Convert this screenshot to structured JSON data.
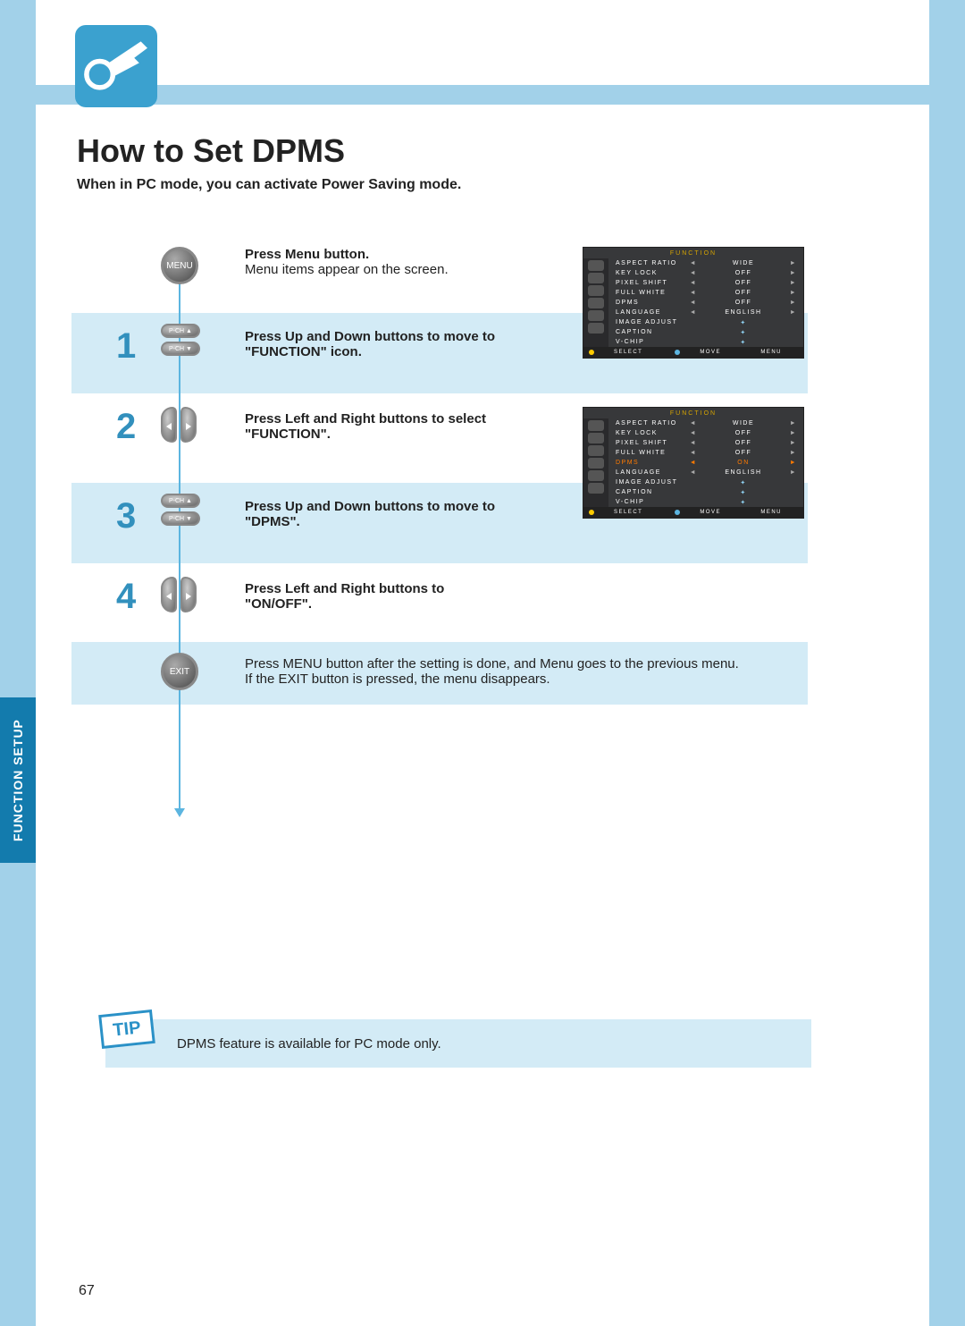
{
  "page_number": "67",
  "side_tab": "FUNCTION SETUP",
  "title": "How to Set DPMS",
  "subtitle": "When in PC mode, you can activate Power Saving mode.",
  "steps": {
    "menu": {
      "icon_label": "MENU",
      "bold": "Press Menu button.",
      "light": "Menu items appear on the screen."
    },
    "s1": {
      "num": "1",
      "pill_up": "P-CH ▲",
      "pill_dn": "P-CH ▼",
      "line1": "Press Up and Down buttons to move to",
      "line2": "\"FUNCTION\" icon."
    },
    "s2": {
      "num": "2",
      "line1": "Press Left and Right buttons to select",
      "line2": "\"FUNCTION\"."
    },
    "s3": {
      "num": "3",
      "pill_up": "P-CH ▲",
      "pill_dn": "P-CH ▼",
      "line1": "Press Up and Down buttons to move to",
      "line2": "\"DPMS\"."
    },
    "s4": {
      "num": "4",
      "line1": "Press Left and Right buttons to",
      "line2": "\"ON/OFF\"."
    },
    "exit": {
      "icon_label": "EXIT",
      "line1": "Press MENU button after the setting is done, and Menu goes to the previous menu.",
      "line2": "If the EXIT button is pressed, the menu disappears."
    }
  },
  "tip": {
    "badge": "TIP",
    "text": "DPMS feature is available for PC mode only."
  },
  "osd": {
    "header": "FUNCTION",
    "rows": [
      {
        "label": "ASPECT RATIO",
        "value": "WIDE",
        "arrows": true
      },
      {
        "label": "KEY LOCK",
        "value": "OFF",
        "arrows": true
      },
      {
        "label": "PIXEL SHIFT",
        "value": "OFF",
        "arrows": true
      },
      {
        "label": "FULL WHITE",
        "value": "OFF",
        "arrows": true
      },
      {
        "label": "DPMS",
        "value": "OFF",
        "arrows": true,
        "hi_key": true
      },
      {
        "label": "LANGUAGE",
        "value": "ENGLISH",
        "arrows": true
      },
      {
        "label": "IMAGE ADJUST",
        "dot": true
      },
      {
        "label": "CAPTION",
        "dot": true
      },
      {
        "label": "V-CHIP",
        "dot": true
      }
    ],
    "rows2_dpms_value": "ON",
    "footer": {
      "a": "SELECT",
      "b": "MOVE",
      "c": "MENU"
    }
  }
}
